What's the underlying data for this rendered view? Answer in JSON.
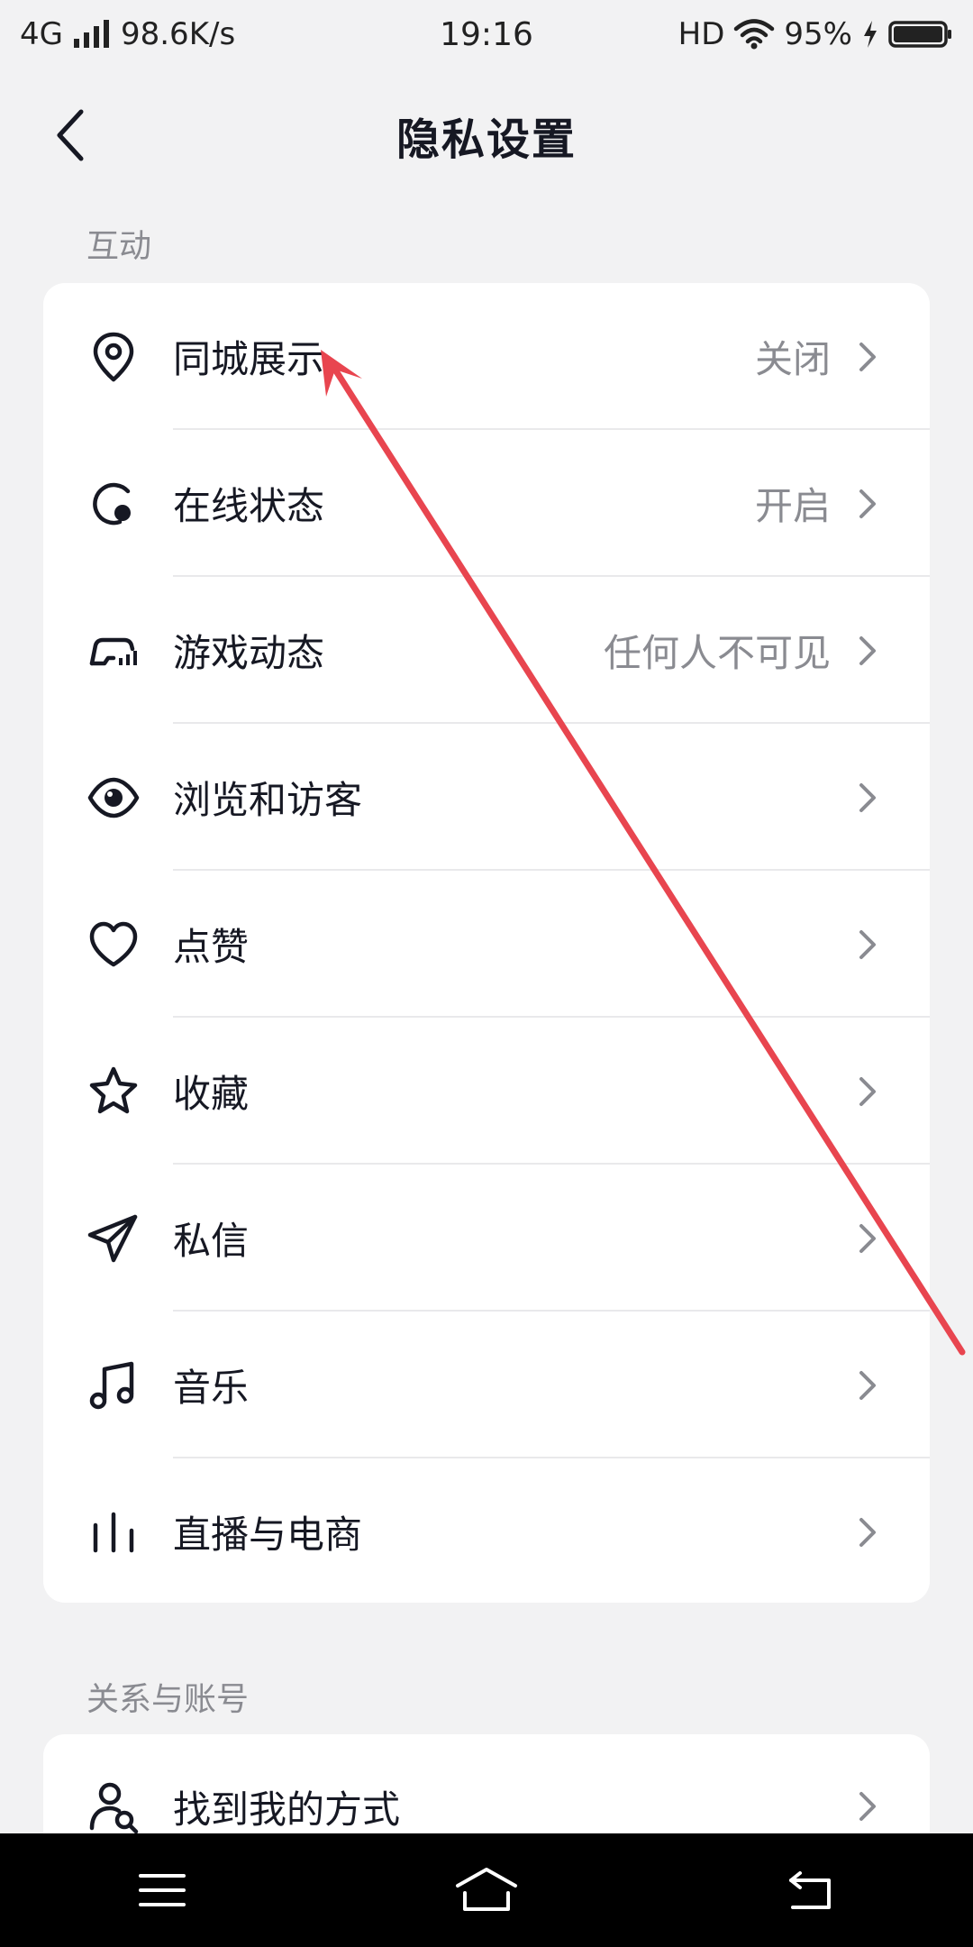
{
  "status_bar": {
    "network": "4G",
    "speed": "98.6K/s",
    "time": "19:16",
    "hd": "HD",
    "battery": "95%"
  },
  "nav": {
    "title": "隐私设置",
    "back_icon": "chevron-left-icon"
  },
  "sections": [
    {
      "label": "互动",
      "items": [
        {
          "icon": "location-pin-icon",
          "label": "同城展示",
          "value": "关闭"
        },
        {
          "icon": "online-status-icon",
          "label": "在线状态",
          "value": "开启"
        },
        {
          "icon": "gamepad-icon",
          "label": "游戏动态",
          "value": "任何人不可见"
        },
        {
          "icon": "eye-icon",
          "label": "浏览和访客",
          "value": ""
        },
        {
          "icon": "heart-icon",
          "label": "点赞",
          "value": ""
        },
        {
          "icon": "star-icon",
          "label": "收藏",
          "value": ""
        },
        {
          "icon": "paper-plane-icon",
          "label": "私信",
          "value": ""
        },
        {
          "icon": "music-note-icon",
          "label": "音乐",
          "value": ""
        },
        {
          "icon": "live-bars-icon",
          "label": "直播与电商",
          "value": ""
        }
      ]
    },
    {
      "label": "关系与账号",
      "items": [
        {
          "icon": "find-user-icon",
          "label": "找到我的方式",
          "value": ""
        }
      ]
    }
  ],
  "colors": {
    "background": "#f2f2f3",
    "card": "#ffffff",
    "text_primary": "#161823",
    "text_secondary": "#8a8b91",
    "annotation_arrow": "#e8454f"
  }
}
